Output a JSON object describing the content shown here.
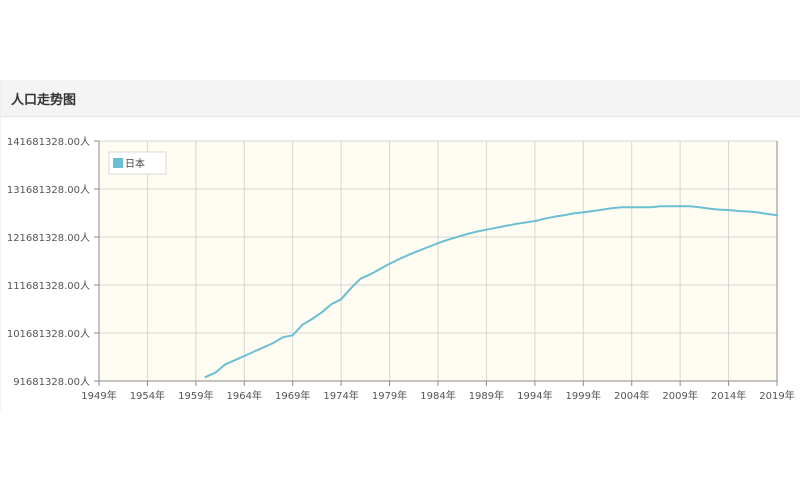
{
  "panel": {
    "title": "人口走势图"
  },
  "chart_data": {
    "type": "line",
    "title": "人口走势图",
    "xlabel": "",
    "ylabel": "",
    "x_ticks": [
      "1949年",
      "1954年",
      "1959年",
      "1964年",
      "1969年",
      "1974年",
      "1979年",
      "1984年",
      "1989年",
      "1994年",
      "1999年",
      "2004年",
      "2009年",
      "2014年",
      "2019年"
    ],
    "y_ticks": [
      "91681328.00人",
      "101681328.00人",
      "111681328.00人",
      "121681328.00人",
      "131681328.00人",
      "141681328.00人"
    ],
    "xlim": [
      1949,
      2019
    ],
    "ylim": [
      91681328,
      141681328
    ],
    "grid": true,
    "legend": "top-left",
    "series": [
      {
        "name": "日本",
        "color": "#6bbfd2",
        "x": [
          1960,
          1961,
          1962,
          1963,
          1964,
          1965,
          1966,
          1967,
          1968,
          1969,
          1970,
          1971,
          1972,
          1973,
          1974,
          1975,
          1976,
          1977,
          1978,
          1979,
          1980,
          1981,
          1982,
          1983,
          1984,
          1985,
          1986,
          1987,
          1988,
          1989,
          1990,
          1991,
          1992,
          1993,
          1994,
          1995,
          1996,
          1997,
          1998,
          1999,
          2000,
          2001,
          2002,
          2003,
          2004,
          2005,
          2006,
          2007,
          2008,
          2009,
          2010,
          2011,
          2012,
          2013,
          2014,
          2015,
          2016,
          2017,
          2018,
          2019
        ],
        "values": [
          92500000,
          93400000,
          95100000,
          96000000,
          96900000,
          97800000,
          98700000,
          99600000,
          100800000,
          101200000,
          103400000,
          104600000,
          106000000,
          107700000,
          108700000,
          111000000,
          113000000,
          113900000,
          115000000,
          116100000,
          117100000,
          118000000,
          118800000,
          119600000,
          120400000,
          121100000,
          121700000,
          122300000,
          122800000,
          123200000,
          123600000,
          124000000,
          124400000,
          124700000,
          125000000,
          125500000,
          125900000,
          126200000,
          126600000,
          126800000,
          127100000,
          127400000,
          127700000,
          127900000,
          127900000,
          127900000,
          127900000,
          128100000,
          128100000,
          128100000,
          128100000,
          127900000,
          127600000,
          127400000,
          127300000,
          127100000,
          127000000,
          126800000,
          126500000,
          126200000
        ]
      }
    ]
  }
}
